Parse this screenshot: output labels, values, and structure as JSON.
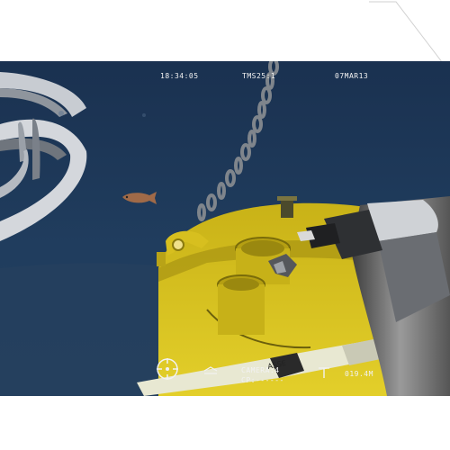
{
  "hud": {
    "time": "18:34:05",
    "tms": "TMS25:1",
    "date": "07MAR13",
    "camera": "CAMERA:4",
    "cp": "CP:------",
    "depth": "019.4M"
  },
  "icons": {
    "compass": "compass-icon",
    "pitch": "pitch-indicator-icon",
    "tether": "tether-icon"
  },
  "colors": {
    "water": "#1d3654",
    "buoy": "#d8c21a",
    "hud_text": "#f2f2f2"
  }
}
